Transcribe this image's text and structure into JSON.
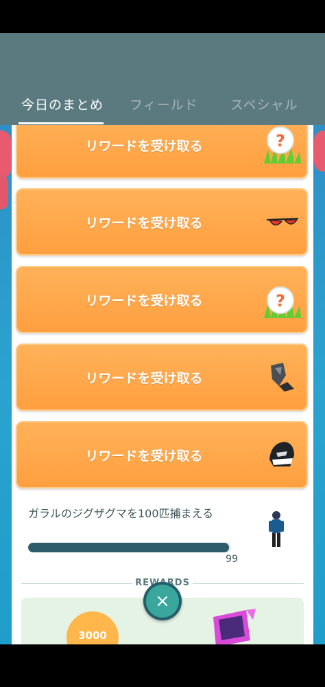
{
  "tabs": [
    {
      "label": "今日のまとめ",
      "active": true
    },
    {
      "label": "フィールド",
      "active": false
    },
    {
      "label": "スペシャル",
      "active": false
    }
  ],
  "reward_buttons": [
    {
      "label": "リワードを受け取る",
      "icon": "mystery-question-icon"
    },
    {
      "label": "リワードを受け取る",
      "icon": "sunglasses-icon"
    },
    {
      "label": "リワードを受け取る",
      "icon": "mystery-question-icon"
    },
    {
      "label": "リワードを受け取る",
      "icon": "wing-item-icon"
    },
    {
      "label": "リワードを受け取る",
      "icon": "helmet-item-icon"
    }
  ],
  "quest": {
    "title": "ガラルのジグザグマを100匹捕まえる",
    "progress_count": "99",
    "progress_fraction": 0.99
  },
  "rewards": {
    "label": "REWARDS",
    "xp": "3000"
  },
  "colors": {
    "header": "#5b7a80",
    "button_orange": "#ff9f3f",
    "progress": "#2e5c6b",
    "close": "#3aa79d"
  }
}
